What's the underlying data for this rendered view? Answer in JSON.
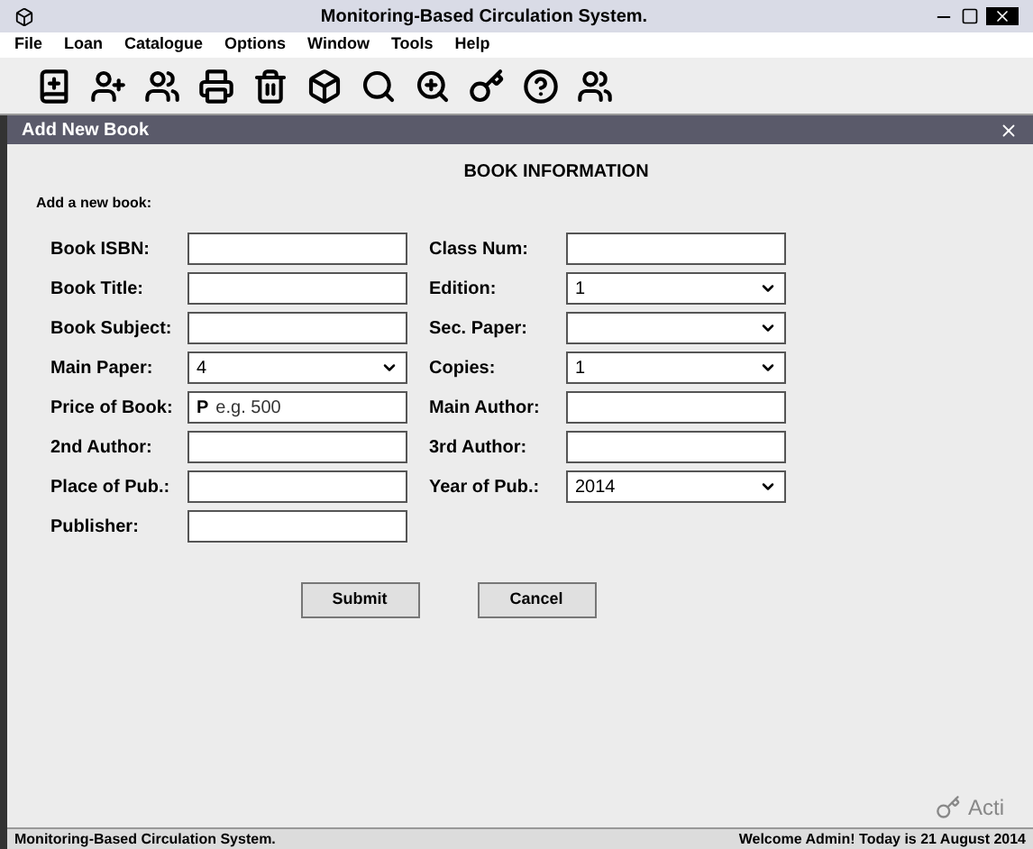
{
  "window": {
    "title": "Monitoring-Based Circulation System."
  },
  "menu": [
    "File",
    "Loan",
    "Catalogue",
    "Options",
    "Window",
    "Tools",
    "Help"
  ],
  "inner_window": {
    "title": "Add New Book"
  },
  "form": {
    "heading": "BOOK INFORMATION",
    "subheading": "Add a new book:",
    "left": [
      {
        "label": "Book ISBN:",
        "kind": "text"
      },
      {
        "label": "Book Title:",
        "kind": "text"
      },
      {
        "label": "Book Subject:",
        "kind": "text"
      },
      {
        "label": "Main Paper:",
        "kind": "select",
        "value": "4"
      },
      {
        "label": "Price of Book:",
        "kind": "price",
        "prefix": "P",
        "placeholder": "e.g. 500"
      },
      {
        "label": "2nd Author:",
        "kind": "text"
      },
      {
        "label": "Place of Pub.:",
        "kind": "text"
      },
      {
        "label": "Publisher:",
        "kind": "text"
      }
    ],
    "right": [
      {
        "label": "Class Num:",
        "kind": "text"
      },
      {
        "label": "Edition:",
        "kind": "select",
        "value": "1"
      },
      {
        "label": "Sec. Paper:",
        "kind": "select"
      },
      {
        "label": "Copies:",
        "kind": "select",
        "value": "1"
      },
      {
        "label": "Main Author:",
        "kind": "text"
      },
      {
        "label": "3rd Author:",
        "kind": "text"
      },
      {
        "label": "Year of Pub.:",
        "kind": "select",
        "value": "2014"
      }
    ],
    "buttons": [
      "Submit",
      "Cancel"
    ]
  },
  "activation_text": "Acti",
  "status_bar": {
    "left": "Monitoring-Based Circulation System.",
    "right": "Welcome Admin! Today is 21 August 2014"
  }
}
